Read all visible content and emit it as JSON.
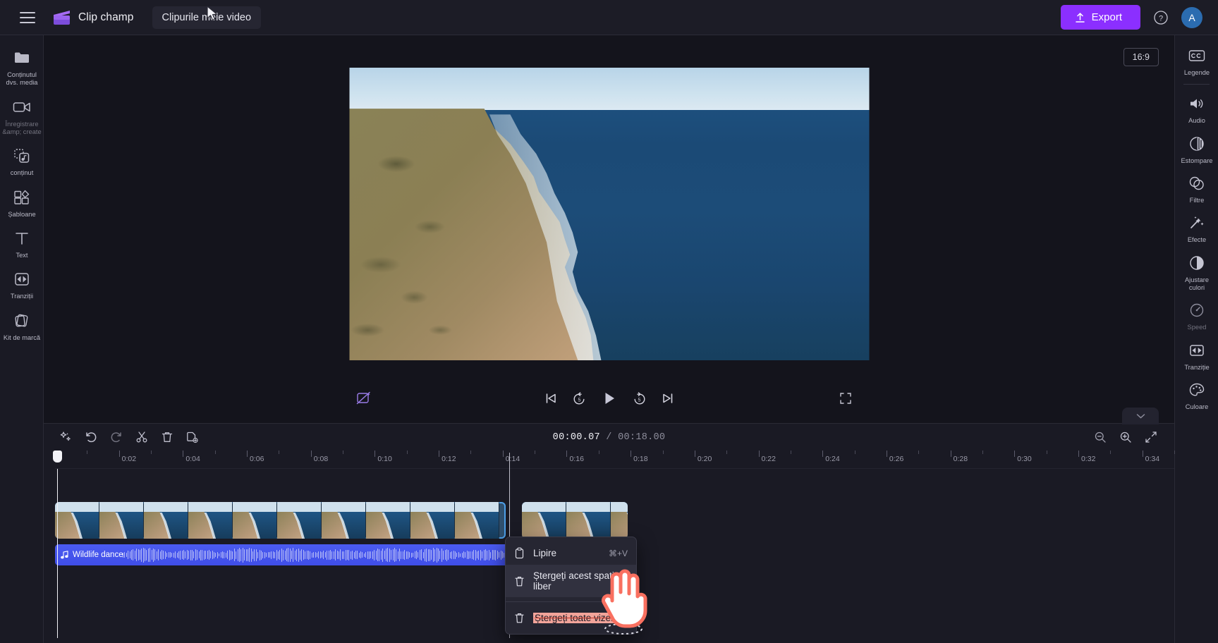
{
  "app": {
    "brand": "Clip champ",
    "project_name": "Clipurile mele video",
    "export_label": "Export",
    "avatar_initial": "A"
  },
  "left_rail": {
    "items": [
      {
        "label": "Conținutul dvs. media",
        "icon": "folder-icon",
        "dim": false
      },
      {
        "label": "Înregistrare &amp; create",
        "icon": "video-camera-icon",
        "dim": true
      },
      {
        "label": "conținut",
        "icon": "content-library-icon",
        "dim": false
      },
      {
        "label": "Șabloane",
        "icon": "templates-icon",
        "dim": false
      },
      {
        "label": "Text",
        "icon": "text-icon",
        "dim": false
      },
      {
        "label": "Tranziții",
        "icon": "transitions-icon",
        "dim": false
      },
      {
        "label": "Kit de marcă",
        "icon": "brand-kit-icon",
        "dim": false
      }
    ]
  },
  "right_rail": {
    "items": [
      {
        "label": "Legende",
        "icon": "captions-cc-icon",
        "dim": false
      },
      {
        "label": "Audio",
        "icon": "speaker-icon",
        "dim": false
      },
      {
        "label": "Estompare",
        "icon": "fade-icon",
        "dim": false
      },
      {
        "label": "Filtre",
        "icon": "filters-icon",
        "dim": false
      },
      {
        "label": "Efecte",
        "icon": "effects-wand-icon",
        "dim": false
      },
      {
        "label": "Ajustare culori",
        "icon": "color-adjust-icon",
        "dim": false
      },
      {
        "label": "Speed",
        "icon": "speedometer-icon",
        "dim": true
      },
      {
        "label": "Tranziție",
        "icon": "transition-icon",
        "dim": false
      },
      {
        "label": "Culoare",
        "icon": "palette-icon",
        "dim": false
      }
    ]
  },
  "stage": {
    "aspect_ratio": "16:9",
    "preview_alt": "aerial view of coastal cliff and ocean"
  },
  "player": {
    "autofix_icon": "auto-enhance-off-icon",
    "skip_start_icon": "skip-to-start-icon",
    "back5_icon": "rewind-5-icon",
    "play_icon": "play-icon",
    "fwd5_icon": "forward-5-icon",
    "skip_end_icon": "skip-to-end-icon",
    "fullscreen_icon": "fullscreen-icon"
  },
  "timeline": {
    "current_time": "00:00.07",
    "total_time": "00:18.00",
    "time_separator": "/",
    "tools": [
      {
        "name": "magic-sparkle-icon"
      },
      {
        "name": "undo-icon"
      },
      {
        "name": "redo-icon"
      },
      {
        "name": "split-scissors-icon"
      },
      {
        "name": "delete-trash-icon"
      },
      {
        "name": "duplicate-icon"
      }
    ],
    "zoom_tools": [
      {
        "name": "zoom-out-icon"
      },
      {
        "name": "zoom-in-icon"
      },
      {
        "name": "fit-to-screen-icon"
      }
    ],
    "collapse_icon": "chevron-down-icon",
    "ruler_labels": [
      "0",
      "0:02",
      "0:04",
      "0:06",
      "0:08",
      "0:10",
      "0:12",
      "0:14",
      "0:16",
      "0:18",
      "0:20",
      "0:22",
      "0:24",
      "0:26",
      "0:28",
      "0:30",
      "0:32",
      "0:34"
    ],
    "ruler_start_sec": 0,
    "ruler_end_sec": 35,
    "playhead_time_sec": 0.07,
    "secondary_marker_sec": 14.2,
    "video_clips": [
      {
        "start_sec": 0,
        "end_sec": 14.1,
        "selected": true,
        "thumbs": 10
      },
      {
        "start_sec": 14.6,
        "end_sec": 17.9,
        "selected": true,
        "thumbs": 3
      }
    ],
    "audio_clips": [
      {
        "title": "Wildlife dance",
        "icon": "music-note-icon",
        "start_sec": 0,
        "end_sec": 17.9
      }
    ]
  },
  "context_menu": {
    "items": [
      {
        "label": "Lipire",
        "icon": "clipboard-paste-icon",
        "shortcut": "⌘+V",
        "hover": false,
        "highlight": false,
        "strike": false
      },
      {
        "label": "Ștergeți acest spațiu liber",
        "icon": "trash-icon",
        "shortcut": "",
        "hover": true,
        "highlight": false,
        "strike": false
      },
      {
        "label": "Ștergeți toate vizele",
        "icon": "trash-icon",
        "shortcut": "",
        "hover": false,
        "highlight": true,
        "strike": true
      }
    ]
  },
  "colors": {
    "accent_purple": "#8b2fff",
    "audio_blue": "#4b5bf0",
    "clip_border_blue": "#4d9fe8",
    "panel_bg": "#1a1a24",
    "app_bg": "#14141c",
    "highlight_salmon": "#f2a49a"
  }
}
